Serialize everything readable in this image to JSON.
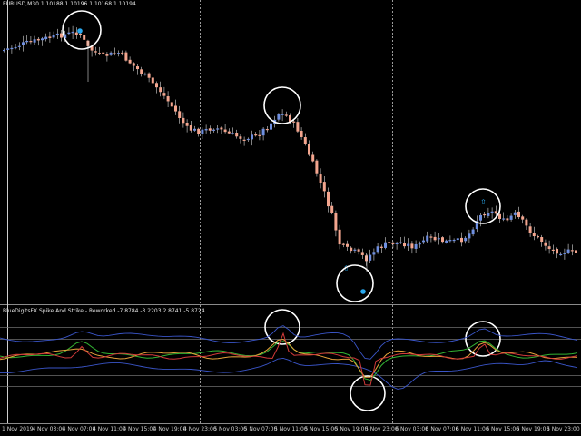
{
  "window": {
    "symbol_timeframe": "EURUSD,M30",
    "ohlc": "1.10188 1.10196 1.10168 1.10194"
  },
  "indicator": {
    "title": "BlueDigitsFX Spike And Strike - Reworked",
    "values": "-7.8784 -3.2203 2.8741 -5.8724"
  },
  "time_axis": [
    "1 Nov 2019",
    "4 Nov 03:00",
    "4 Nov 07:00",
    "4 Nov 11:00",
    "4 Nov 15:00",
    "4 Nov 19:00",
    "4 Nov 23:00",
    "5 Nov 03:00",
    "5 Nov 07:00",
    "5 Nov 11:00",
    "5 Nov 15:00",
    "5 Nov 19:00",
    "5 Nov 23:00",
    "6 Nov 03:00",
    "6 Nov 07:00",
    "6 Nov 11:00",
    "6 Nov 15:00",
    "6 Nov 19:00",
    "6 Nov 23:00"
  ],
  "colors": {
    "bull": "#6f8fe0",
    "bear": "#f3a58e",
    "wick": "#d8d8d8",
    "marker": "#29a9ef",
    "circle": "#ffffff",
    "separator": "#9a9a9a",
    "ind_blue": "#3a55c8",
    "ind_red": "#d23a3a",
    "ind_green": "#33b233",
    "ind_orange": "#e3a03a"
  }
}
